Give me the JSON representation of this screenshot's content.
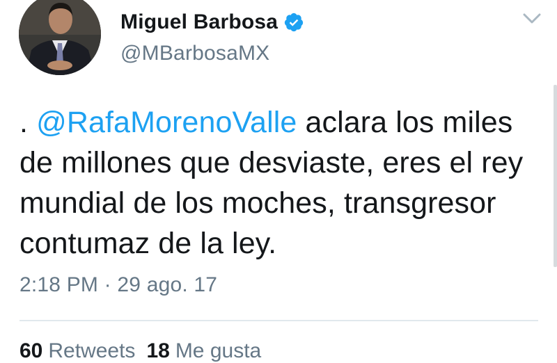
{
  "author": {
    "display_name": "Miguel Barbosa",
    "handle": "@MBarbosaMX",
    "verified": true,
    "avatar_icon": "profile-photo"
  },
  "menu_icon": "chevron-down-icon",
  "tweet": {
    "prefix": ". ",
    "mention": "@RafaMorenoValle",
    "text_rest": " aclara los miles de millones que desviaste, eres el rey mundial de los moches, transgresor contumaz de la ley.",
    "timestamp": "2:18 PM · 29 ago. 17"
  },
  "stats": {
    "retweets_count": "60",
    "retweets_label": "Retweets",
    "likes_count": "18",
    "likes_label": "Me gusta"
  },
  "colors": {
    "link": "#1da1f2",
    "verified_badge": "#1da1f2",
    "secondary_text": "#657786",
    "primary_text": "#14171a",
    "divider": "#e1e8ed"
  }
}
